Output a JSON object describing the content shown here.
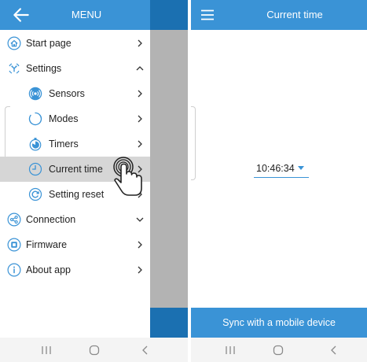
{
  "drawer": {
    "title": "MENU",
    "items": [
      {
        "label": "Start page",
        "icon": "home-icon",
        "chevron": "right"
      },
      {
        "label": "Settings",
        "icon": "settings-icon",
        "chevron": "up"
      },
      {
        "label": "Sensors",
        "icon": "sensor-icon",
        "chevron": "right"
      },
      {
        "label": "Modes",
        "icon": "modes-icon",
        "chevron": "right"
      },
      {
        "label": "Timers",
        "icon": "timer-icon",
        "chevron": "right"
      },
      {
        "label": "Current time",
        "icon": "clock-icon",
        "chevron": "right",
        "selected": true
      },
      {
        "label": "Setting reset",
        "icon": "reset-icon",
        "chevron": "right"
      },
      {
        "label": "Connection",
        "icon": "share-icon",
        "chevron": "down"
      },
      {
        "label": "Firmware",
        "icon": "firmware-icon",
        "chevron": "right"
      },
      {
        "label": "About app",
        "icon": "info-icon",
        "chevron": "right"
      }
    ]
  },
  "screen": {
    "title": "Current time",
    "time_value": "10:46:34",
    "sync_button": "Sync with a mobile device"
  },
  "colors": {
    "accent": "#3a93d6",
    "accent_dark": "#1b70b1",
    "scrim": "#b3b3b3",
    "selected_row": "#d6d6d6"
  },
  "nav_bar": {
    "icons": [
      "recent-apps-icon",
      "home-button-icon",
      "back-button-icon"
    ]
  }
}
